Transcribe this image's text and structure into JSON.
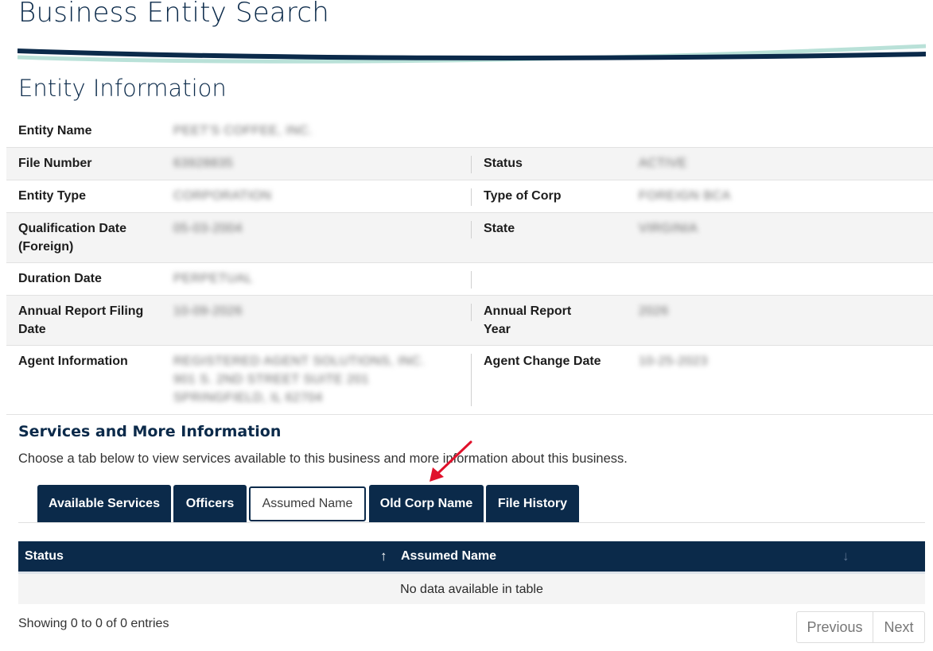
{
  "page": {
    "title": "Business Entity Search"
  },
  "entity_section": {
    "title": "Entity Information",
    "rows": [
      {
        "label1": "Entity Name",
        "value1": "PEET'S COFFEE, INC.",
        "label2": "",
        "value2": ""
      },
      {
        "label1": "File Number",
        "value1": "63928835",
        "label2": "Status",
        "value2": "ACTIVE"
      },
      {
        "label1": "Entity Type",
        "value1": "CORPORATION",
        "label2": "Type of Corp",
        "value2": "FOREIGN BCA"
      },
      {
        "label1": "Qualification Date (Foreign)",
        "value1": "05-03-2004",
        "label2": "State",
        "value2": "VIRGINIA"
      },
      {
        "label1": "Duration Date",
        "value1": "PERPETUAL",
        "label2": "",
        "value2": ""
      },
      {
        "label1": "Annual Report Filing Date",
        "value1": "10-09-2026",
        "label2": "Annual Report Year",
        "value2": "2026"
      },
      {
        "label1": "Agent Information",
        "value1": "REGISTERED AGENT SOLUTIONS, INC.",
        "value1_line2": "901 S. 2ND STREET SUITE 201",
        "value1_line3": "SPRINGFIELD, IL 62704",
        "label2": "Agent Change Date",
        "value2": "10-25-2023"
      }
    ]
  },
  "services": {
    "heading": "Services and More Information",
    "description": "Choose a tab below to view services available to this business and more information about this business.",
    "tabs": [
      {
        "label": "Available Services",
        "active": false
      },
      {
        "label": "Officers",
        "active": false
      },
      {
        "label": "Assumed Name",
        "active": true
      },
      {
        "label": "Old Corp Name",
        "active": false
      },
      {
        "label": "File History",
        "active": false
      }
    ]
  },
  "table": {
    "columns": [
      "Status",
      "Assumed Name"
    ],
    "sort_icons": [
      "arrow-up-icon",
      "arrow-down-icon"
    ],
    "empty_message": "No data available in table",
    "info": "Showing 0 to 0 of 0 entries",
    "prev_label": "Previous",
    "next_label": "Next"
  },
  "colors": {
    "navy": "#0b2a4a",
    "teal": "#b9e1d8",
    "annotation_red": "#e0112b"
  }
}
